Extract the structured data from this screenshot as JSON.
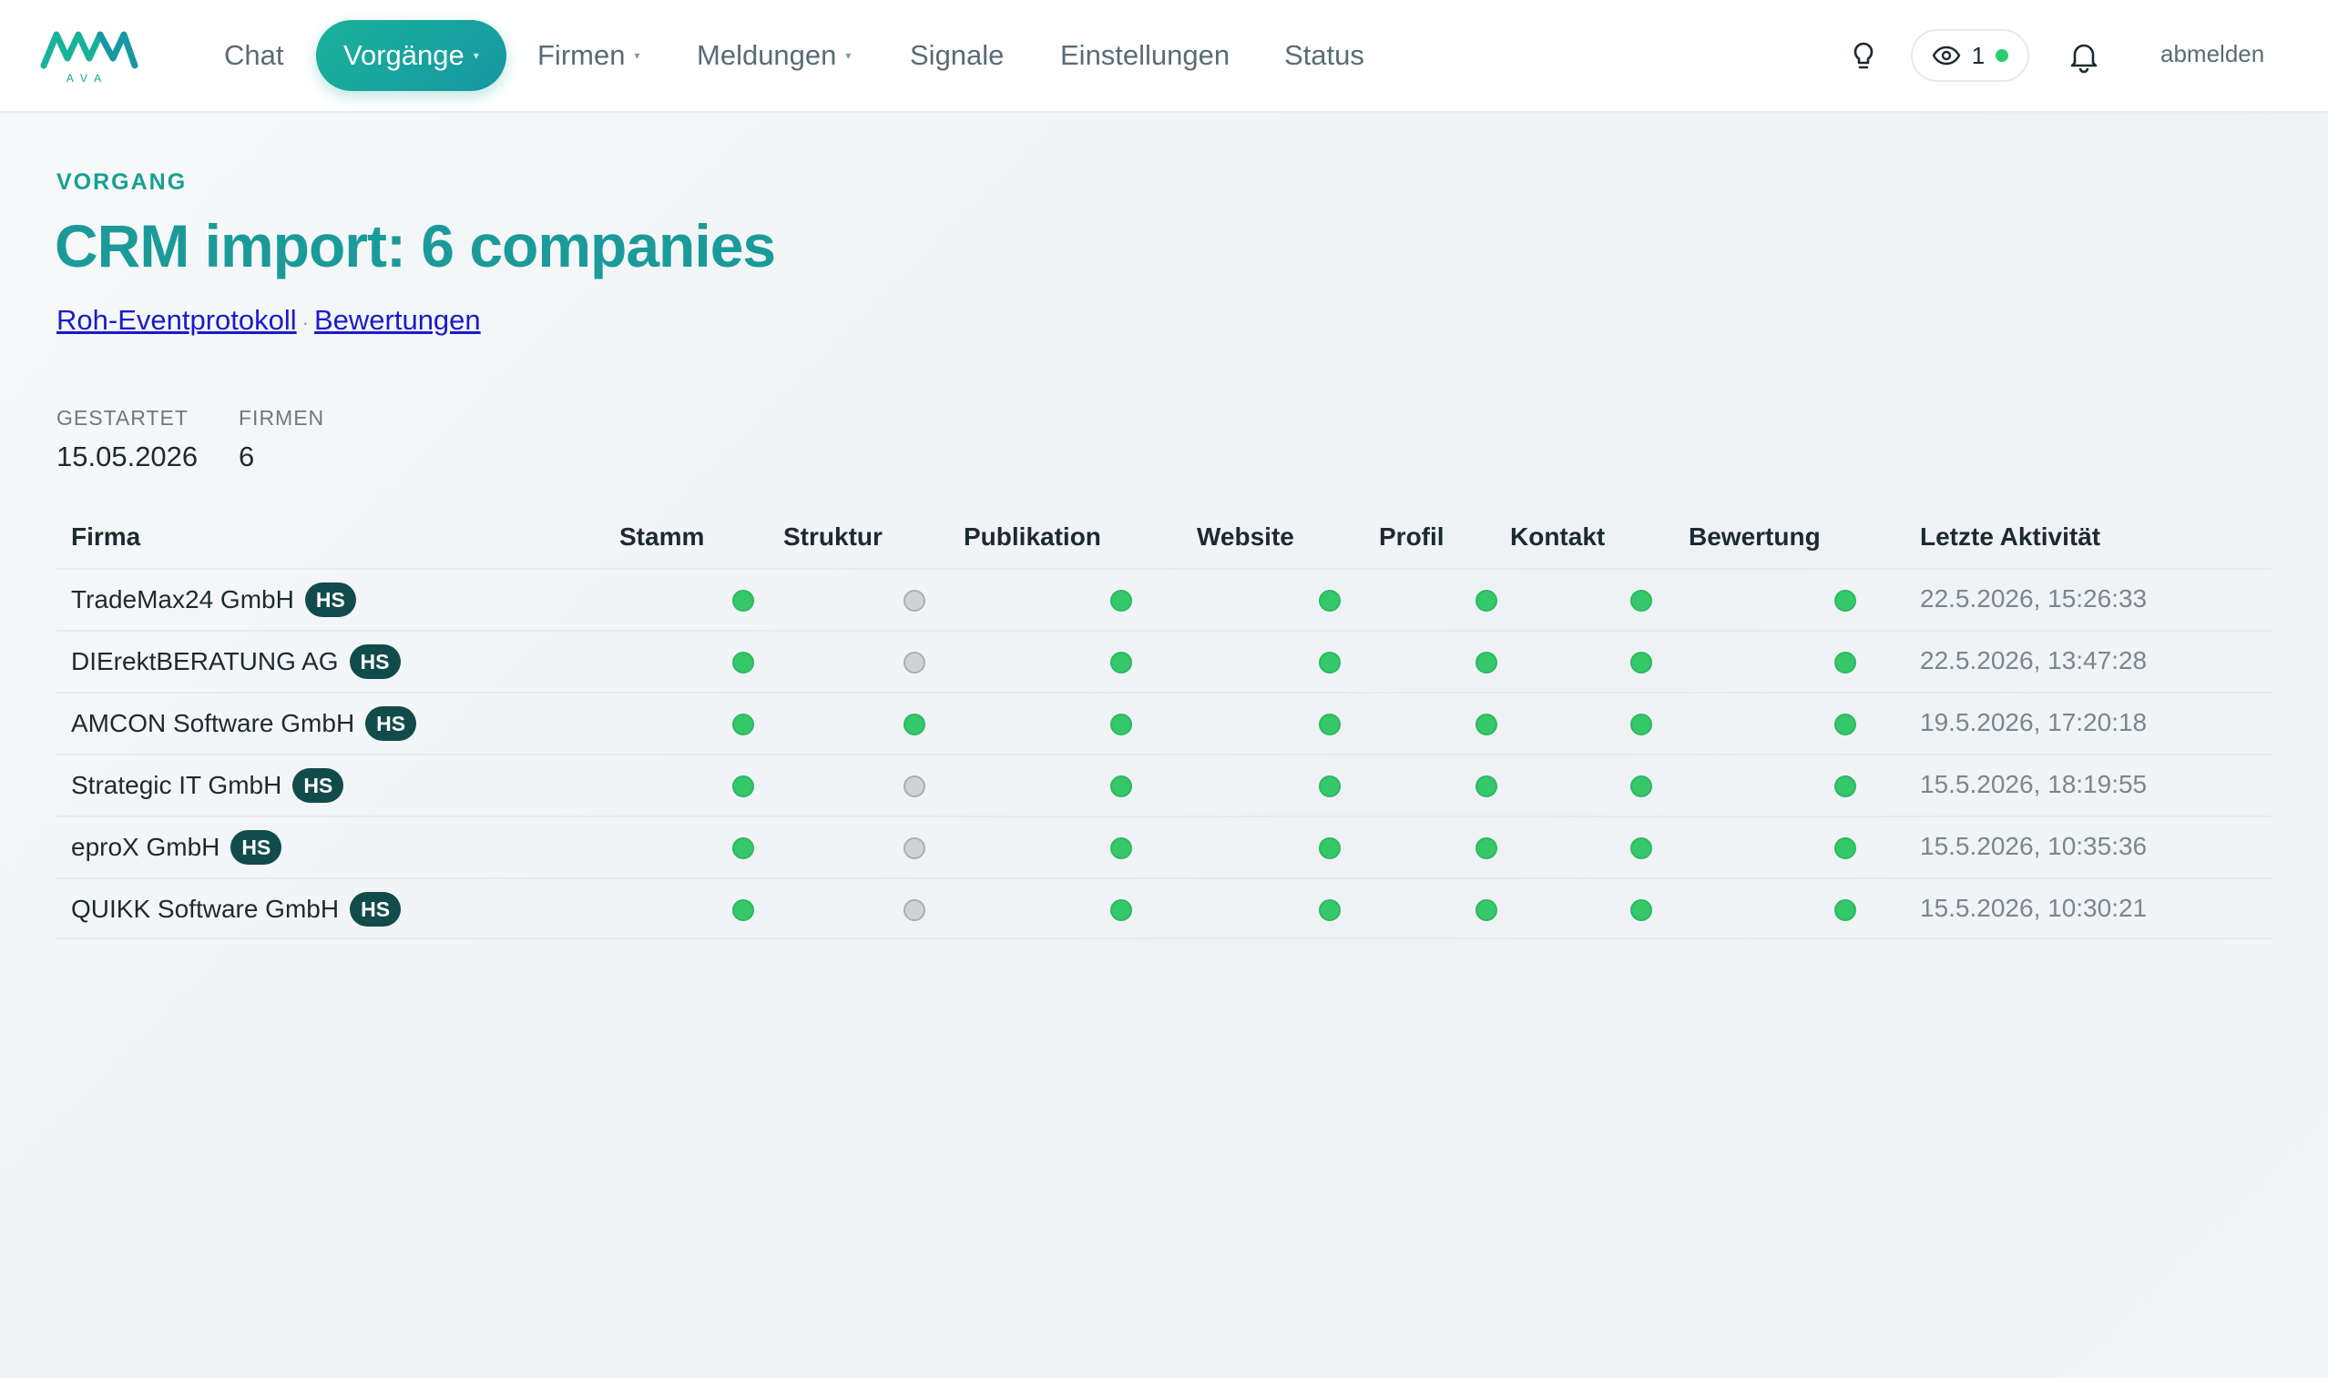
{
  "nav": {
    "logo_text": "AVA",
    "items": [
      {
        "label": "Chat",
        "has_caret": false,
        "active": false
      },
      {
        "label": "Vorgänge",
        "has_caret": true,
        "active": true
      },
      {
        "label": "Firmen",
        "has_caret": true,
        "active": false
      },
      {
        "label": "Meldungen",
        "has_caret": true,
        "active": false
      },
      {
        "label": "Signale",
        "has_caret": false,
        "active": false
      },
      {
        "label": "Einstellungen",
        "has_caret": false,
        "active": false
      },
      {
        "label": "Status",
        "has_caret": false,
        "active": false
      }
    ],
    "caret": "▾",
    "viewer_count": "1",
    "logout_label": "abmelden",
    "icons": [
      "lightbulb-icon",
      "eye-icon",
      "bell-icon"
    ]
  },
  "page": {
    "eyebrow": "VORGANG",
    "title": "CRM import: 6 companies",
    "links": [
      "Roh-Eventprotokoll",
      "Bewertungen"
    ],
    "link_separator": "·",
    "meta": [
      {
        "label": "GESTARTET",
        "value": "15.05.2026"
      },
      {
        "label": "FIRMEN",
        "value": "6"
      }
    ]
  },
  "table": {
    "columns": [
      "Firma",
      "Stamm",
      "Struktur",
      "Publikation",
      "Website",
      "Profil",
      "Kontakt",
      "Bewertung",
      "Letzte Aktivität"
    ],
    "rows": [
      {
        "firma": "TradeMax24 GmbH",
        "badge": "HS",
        "status": [
          "ok",
          "none",
          "ok",
          "ok",
          "ok",
          "ok",
          "ok"
        ],
        "activity": "22.5.2026, 15:26:33"
      },
      {
        "firma": "DIErektBERATUNG AG",
        "badge": "HS",
        "status": [
          "ok",
          "none",
          "ok",
          "ok",
          "ok",
          "ok",
          "ok"
        ],
        "activity": "22.5.2026, 13:47:28"
      },
      {
        "firma": "AMCON Software GmbH",
        "badge": "HS",
        "status": [
          "ok",
          "ok",
          "ok",
          "ok",
          "ok",
          "ok",
          "ok"
        ],
        "activity": "19.5.2026, 17:20:18"
      },
      {
        "firma": "Strategic IT GmbH",
        "badge": "HS",
        "status": [
          "ok",
          "none",
          "ok",
          "ok",
          "ok",
          "ok",
          "ok"
        ],
        "activity": "15.5.2026, 18:19:55"
      },
      {
        "firma": "eproX GmbH",
        "badge": "HS",
        "status": [
          "ok",
          "none",
          "ok",
          "ok",
          "ok",
          "ok",
          "ok"
        ],
        "activity": "15.5.2026, 10:35:36"
      },
      {
        "firma": "QUIKK Software GmbH",
        "badge": "HS",
        "status": [
          "ok",
          "none",
          "ok",
          "ok",
          "ok",
          "ok",
          "ok"
        ],
        "activity": "15.5.2026, 10:30:21"
      }
    ]
  },
  "colors": {
    "accent": "#1aa69a",
    "title": "#1a9b9a",
    "status_ok": "#34c86a",
    "status_none": "#cfd3d6",
    "badge": "#124b4b"
  }
}
